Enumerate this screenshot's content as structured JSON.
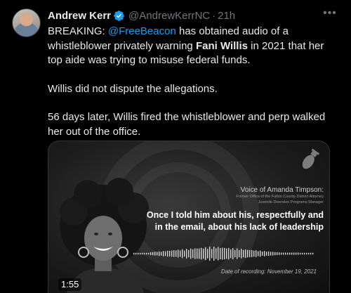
{
  "author": {
    "display_name": "Andrew Kerr",
    "handle": "@AndrewKerrNC",
    "separator": "·",
    "time": "21h",
    "more_icon": "more-horizontal-icon",
    "verified_icon": "verified-badge-icon"
  },
  "tweet": {
    "p1_prefix": "BREAKING: ",
    "p1_mention": "@FreeBeacon",
    "p1_mid": " has obtained audio of a whistleblower privately warning ",
    "p1_bold": "Fani Willis",
    "p1_suffix": " in 2021 that her top aide was trying to misuse federal funds.",
    "p2": "Willis did not dispute the allegations.",
    "p3": "56 days later, Willis fired the whistleblower and perp walked her out of the office."
  },
  "media": {
    "voice_title": "Voice of Amanda Timpson:",
    "voice_sub_1": "Former Office of the Fulton County District Attorney",
    "voice_sub_2": "Juvenile Diversion Programs Manager",
    "quote": "Once I told him about his, respectfully and in the email, about his lack of leadership",
    "recording_date": "Date of recording: November 19, 2021",
    "duration": "1:55",
    "logo_icon": "free-beacon-bomb-icon"
  },
  "colors": {
    "background": "#000000",
    "text": "#e7e9ea",
    "muted": "#71767b",
    "accent": "#1d9bf0"
  }
}
